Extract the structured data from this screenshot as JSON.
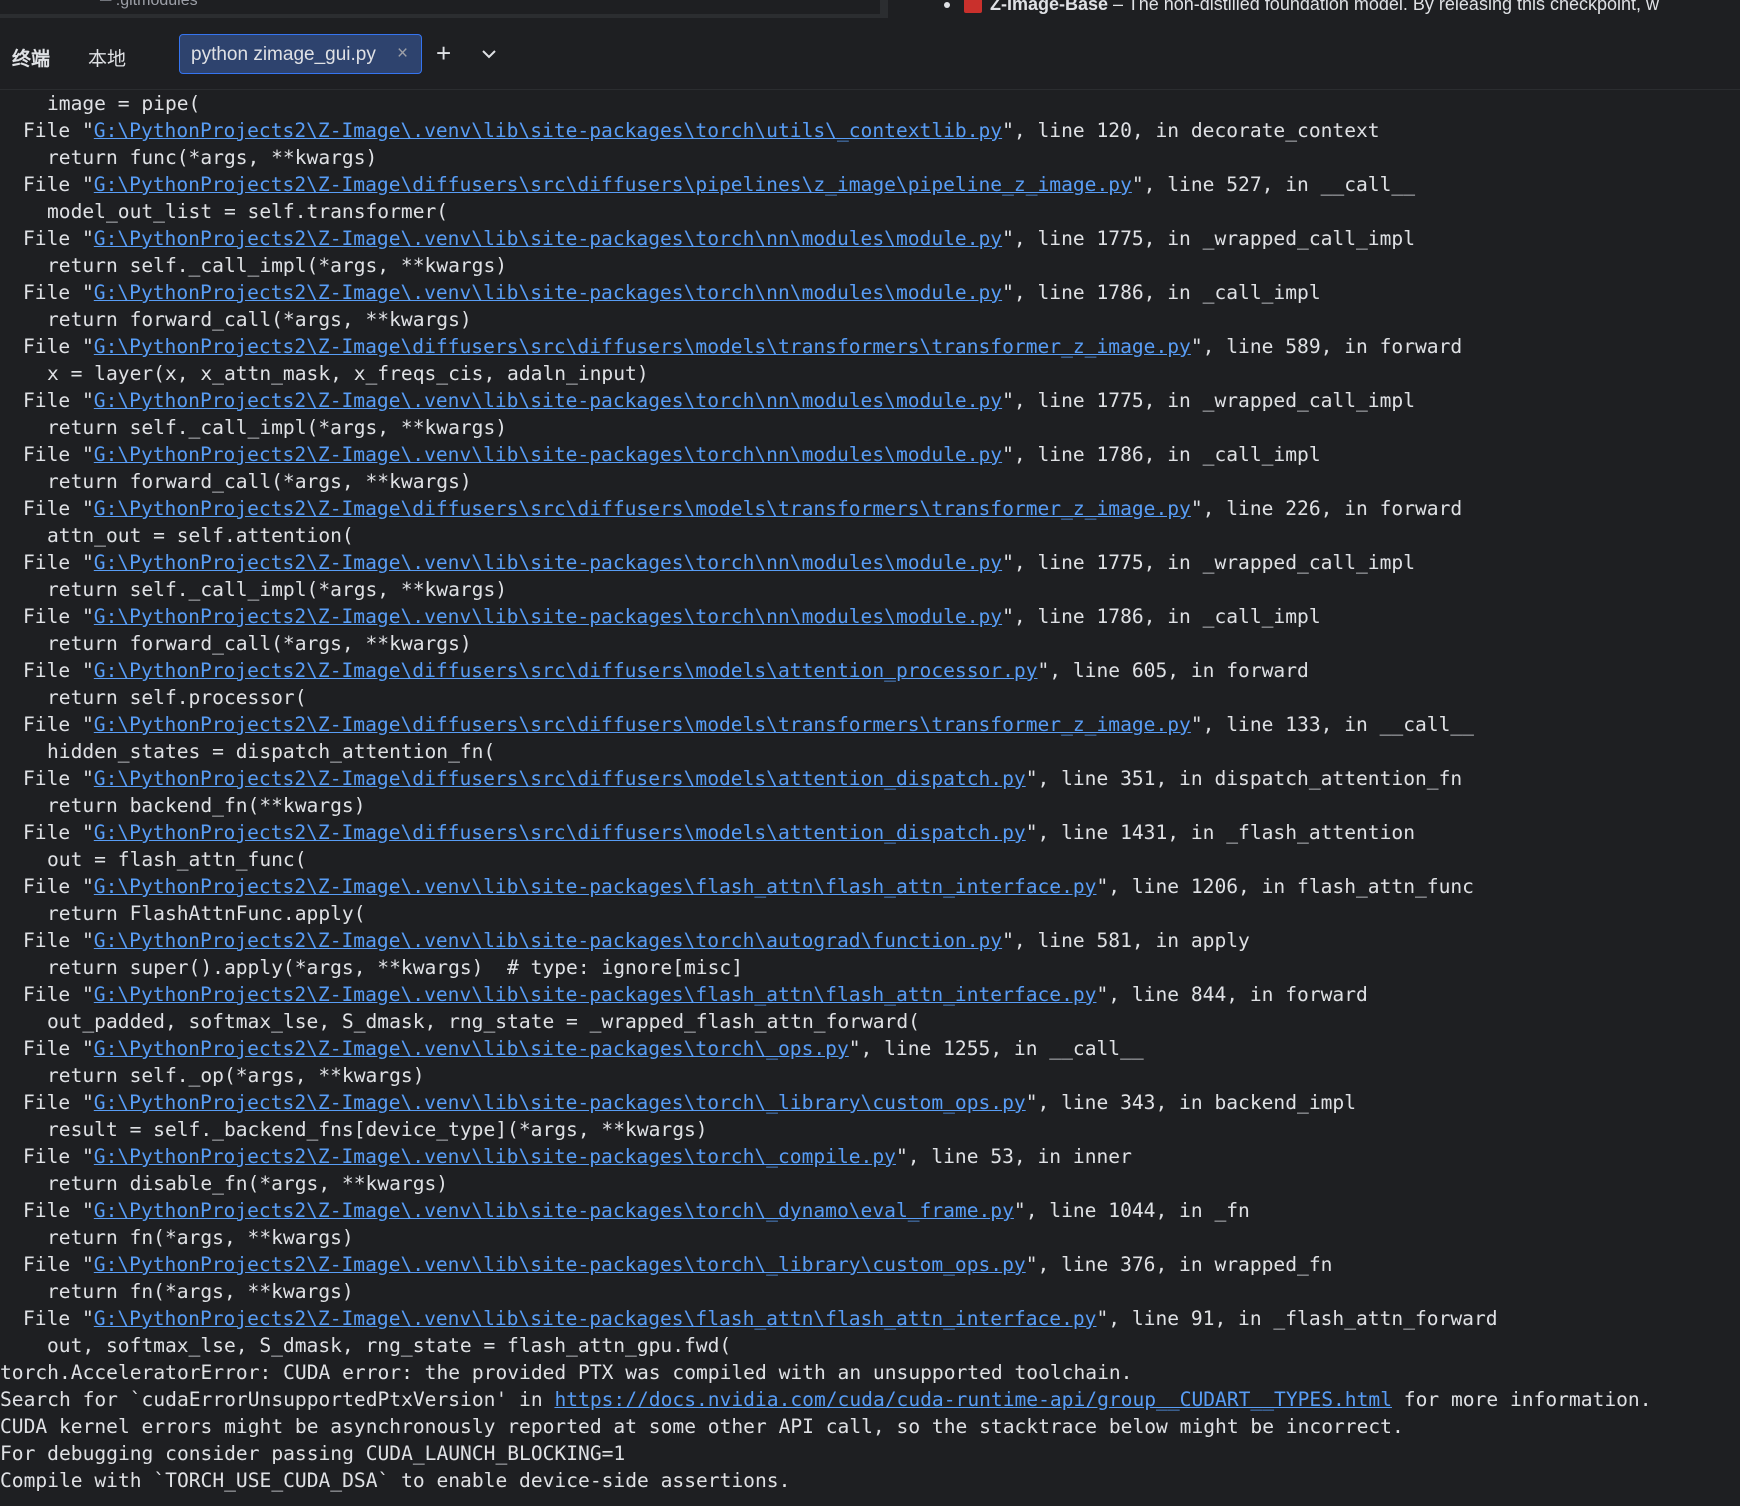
{
  "editor_top": {
    "left_file_fragment": "─ .gitmodules",
    "right_line_bold": "Z-Image-Base",
    "right_line_dash": " – ",
    "right_line_rest": "The non-distilled foundation model. By releasing this checkpoint, w"
  },
  "terminal_panel": {
    "title": "终端",
    "tabs": [
      {
        "label": "本地",
        "active": false
      },
      {
        "label": "python zimage_gui.py",
        "active": true
      }
    ],
    "close_glyph": "×",
    "new_tab_glyph": "+"
  },
  "terminal_output": [
    {
      "kind": "code",
      "text": "image = pipe("
    },
    {
      "kind": "file",
      "path": "G:\\PythonProjects2\\Z-Image\\.venv\\lib\\site-packages\\torch\\utils\\_contextlib.py",
      "rest": "\", line 120, in decorate_context"
    },
    {
      "kind": "code",
      "text": "return func(*args, **kwargs)"
    },
    {
      "kind": "file",
      "path": "G:\\PythonProjects2\\Z-Image\\diffusers\\src\\diffusers\\pipelines\\z_image\\pipeline_z_image.py",
      "rest": "\", line 527, in __call__"
    },
    {
      "kind": "code",
      "text": "model_out_list = self.transformer("
    },
    {
      "kind": "file",
      "path": "G:\\PythonProjects2\\Z-Image\\.venv\\lib\\site-packages\\torch\\nn\\modules\\module.py",
      "rest": "\", line 1775, in _wrapped_call_impl"
    },
    {
      "kind": "code",
      "text": "return self._call_impl(*args, **kwargs)"
    },
    {
      "kind": "file",
      "path": "G:\\PythonProjects2\\Z-Image\\.venv\\lib\\site-packages\\torch\\nn\\modules\\module.py",
      "rest": "\", line 1786, in _call_impl"
    },
    {
      "kind": "code",
      "text": "return forward_call(*args, **kwargs)"
    },
    {
      "kind": "file",
      "path": "G:\\PythonProjects2\\Z-Image\\diffusers\\src\\diffusers\\models\\transformers\\transformer_z_image.py",
      "rest": "\", line 589, in forward"
    },
    {
      "kind": "code",
      "text": "x = layer(x, x_attn_mask, x_freqs_cis, adaln_input)"
    },
    {
      "kind": "file",
      "path": "G:\\PythonProjects2\\Z-Image\\.venv\\lib\\site-packages\\torch\\nn\\modules\\module.py",
      "rest": "\", line 1775, in _wrapped_call_impl"
    },
    {
      "kind": "code",
      "text": "return self._call_impl(*args, **kwargs)"
    },
    {
      "kind": "file",
      "path": "G:\\PythonProjects2\\Z-Image\\.venv\\lib\\site-packages\\torch\\nn\\modules\\module.py",
      "rest": "\", line 1786, in _call_impl"
    },
    {
      "kind": "code",
      "text": "return forward_call(*args, **kwargs)"
    },
    {
      "kind": "file",
      "path": "G:\\PythonProjects2\\Z-Image\\diffusers\\src\\diffusers\\models\\transformers\\transformer_z_image.py",
      "rest": "\", line 226, in forward"
    },
    {
      "kind": "code",
      "text": "attn_out = self.attention("
    },
    {
      "kind": "file",
      "path": "G:\\PythonProjects2\\Z-Image\\.venv\\lib\\site-packages\\torch\\nn\\modules\\module.py",
      "rest": "\", line 1775, in _wrapped_call_impl"
    },
    {
      "kind": "code",
      "text": "return self._call_impl(*args, **kwargs)"
    },
    {
      "kind": "file",
      "path": "G:\\PythonProjects2\\Z-Image\\.venv\\lib\\site-packages\\torch\\nn\\modules\\module.py",
      "rest": "\", line 1786, in _call_impl"
    },
    {
      "kind": "code",
      "text": "return forward_call(*args, **kwargs)"
    },
    {
      "kind": "file",
      "path": "G:\\PythonProjects2\\Z-Image\\diffusers\\src\\diffusers\\models\\attention_processor.py",
      "rest": "\", line 605, in forward"
    },
    {
      "kind": "code",
      "text": "return self.processor("
    },
    {
      "kind": "file",
      "path": "G:\\PythonProjects2\\Z-Image\\diffusers\\src\\diffusers\\models\\transformers\\transformer_z_image.py",
      "rest": "\", line 133, in __call__"
    },
    {
      "kind": "code",
      "text": "hidden_states = dispatch_attention_fn("
    },
    {
      "kind": "file",
      "path": "G:\\PythonProjects2\\Z-Image\\diffusers\\src\\diffusers\\models\\attention_dispatch.py",
      "rest": "\", line 351, in dispatch_attention_fn"
    },
    {
      "kind": "code",
      "text": "return backend_fn(**kwargs)"
    },
    {
      "kind": "file",
      "path": "G:\\PythonProjects2\\Z-Image\\diffusers\\src\\diffusers\\models\\attention_dispatch.py",
      "rest": "\", line 1431, in _flash_attention"
    },
    {
      "kind": "code",
      "text": "out = flash_attn_func("
    },
    {
      "kind": "file",
      "path": "G:\\PythonProjects2\\Z-Image\\.venv\\lib\\site-packages\\flash_attn\\flash_attn_interface.py",
      "rest": "\", line 1206, in flash_attn_func"
    },
    {
      "kind": "code",
      "text": "return FlashAttnFunc.apply("
    },
    {
      "kind": "file",
      "path": "G:\\PythonProjects2\\Z-Image\\.venv\\lib\\site-packages\\torch\\autograd\\function.py",
      "rest": "\", line 581, in apply"
    },
    {
      "kind": "code",
      "text": "return super().apply(*args, **kwargs)  # type: ignore[misc]"
    },
    {
      "kind": "file",
      "path": "G:\\PythonProjects2\\Z-Image\\.venv\\lib\\site-packages\\flash_attn\\flash_attn_interface.py",
      "rest": "\", line 844, in forward"
    },
    {
      "kind": "code",
      "text": "out_padded, softmax_lse, S_dmask, rng_state = _wrapped_flash_attn_forward("
    },
    {
      "kind": "file",
      "path": "G:\\PythonProjects2\\Z-Image\\.venv\\lib\\site-packages\\torch\\_ops.py",
      "rest": "\", line 1255, in __call__"
    },
    {
      "kind": "code",
      "text": "return self._op(*args, **kwargs)"
    },
    {
      "kind": "file",
      "path": "G:\\PythonProjects2\\Z-Image\\.venv\\lib\\site-packages\\torch\\_library\\custom_ops.py",
      "rest": "\", line 343, in backend_impl"
    },
    {
      "kind": "code",
      "text": "result = self._backend_fns[device_type](*args, **kwargs)"
    },
    {
      "kind": "file",
      "path": "G:\\PythonProjects2\\Z-Image\\.venv\\lib\\site-packages\\torch\\_compile.py",
      "rest": "\", line 53, in inner"
    },
    {
      "kind": "code",
      "text": "return disable_fn(*args, **kwargs)"
    },
    {
      "kind": "file",
      "path": "G:\\PythonProjects2\\Z-Image\\.venv\\lib\\site-packages\\torch\\_dynamo\\eval_frame.py",
      "rest": "\", line 1044, in _fn"
    },
    {
      "kind": "code",
      "text": "return fn(*args, **kwargs)"
    },
    {
      "kind": "file",
      "path": "G:\\PythonProjects2\\Z-Image\\.venv\\lib\\site-packages\\torch\\_library\\custom_ops.py",
      "rest": "\", line 376, in wrapped_fn"
    },
    {
      "kind": "code",
      "text": "return fn(*args, **kwargs)"
    },
    {
      "kind": "file",
      "path": "G:\\PythonProjects2\\Z-Image\\.venv\\lib\\site-packages\\flash_attn\\flash_attn_interface.py",
      "rest": "\", line 91, in _flash_attn_forward"
    },
    {
      "kind": "code",
      "text": "out, softmax_lse, S_dmask, rng_state = flash_attn_gpu.fwd("
    },
    {
      "kind": "msg",
      "text": "torch.AcceleratorError: CUDA error: the provided PTX was compiled with an unsupported toolchain."
    },
    {
      "kind": "msglink",
      "before": "Search for `cudaErrorUnsupportedPtxVersion' in ",
      "link": "https://docs.nvidia.com/cuda/cuda-runtime-api/group__CUDART__TYPES.html",
      "after": " for more information."
    },
    {
      "kind": "msg",
      "text": "CUDA kernel errors might be asynchronously reported at some other API call, so the stacktrace below might be incorrect."
    },
    {
      "kind": "msg",
      "text": "For debugging consider passing CUDA_LAUNCH_BLOCKING=1"
    },
    {
      "kind": "msg",
      "text": "Compile with `TORCH_USE_CUDA_DSA` to enable device-side assertions."
    }
  ]
}
